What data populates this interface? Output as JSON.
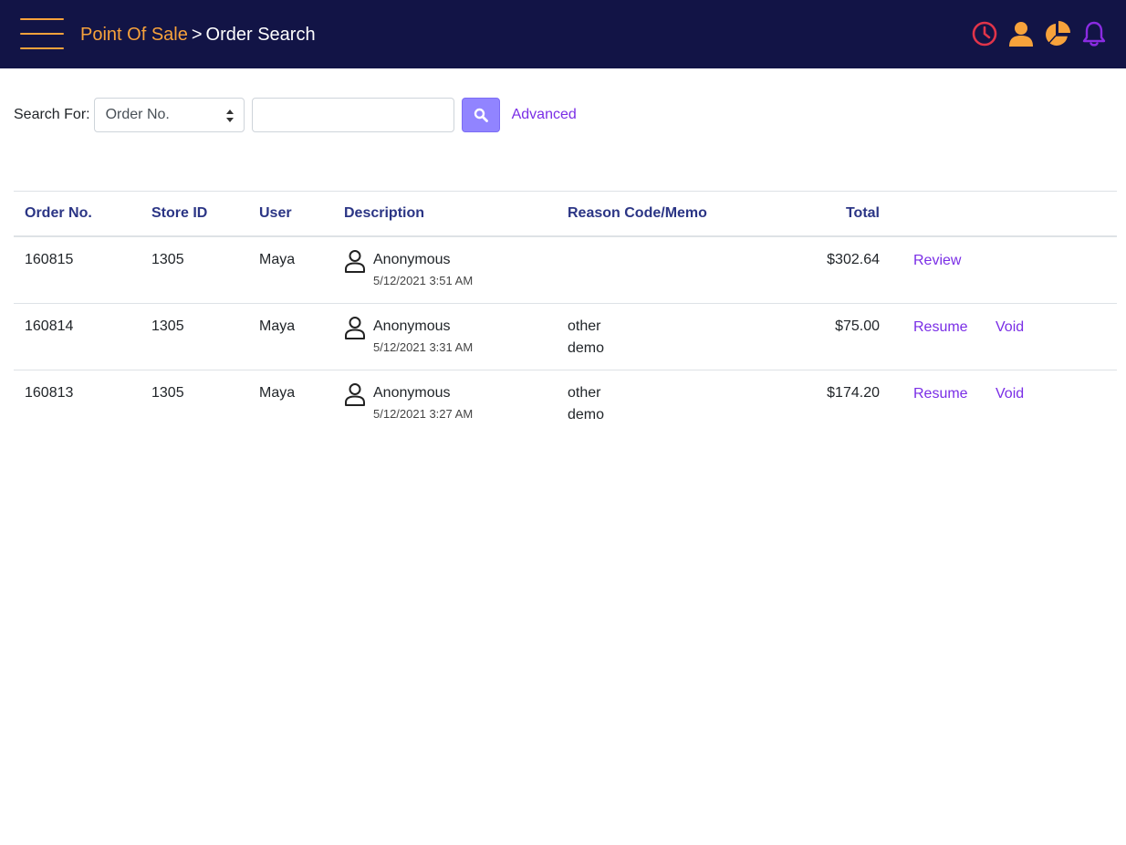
{
  "header": {
    "breadcrumb_home": "Point Of Sale",
    "breadcrumb_sep": ">",
    "breadcrumb_current": "Order Search",
    "icons": [
      "clock-icon",
      "user-icon",
      "pie-chart-icon",
      "bell-icon"
    ],
    "colors": {
      "bar": "#121446",
      "accent": "#f7a23b",
      "clock": "#e0344a",
      "bell": "#8a2be2"
    }
  },
  "search": {
    "label": "Search For:",
    "select_value": "Order No.",
    "input_value": "",
    "advanced_label": "Advanced"
  },
  "table": {
    "headers": [
      "Order No.",
      "Store ID",
      "User",
      "Description",
      "Reason Code/Memo",
      "Total"
    ],
    "rows": [
      {
        "order_no": "160815",
        "store_id": "1305",
        "user": "Maya",
        "desc_name": "Anonymous",
        "desc_date": "5/12/2021 3:51 AM",
        "memo_line1": "",
        "memo_line2": "",
        "total": "$302.64",
        "action1": "Review",
        "action2": ""
      },
      {
        "order_no": "160814",
        "store_id": "1305",
        "user": "Maya",
        "desc_name": "Anonymous",
        "desc_date": "5/12/2021 3:31 AM",
        "memo_line1": "other",
        "memo_line2": "demo",
        "total": "$75.00",
        "action1": "Resume",
        "action2": "Void"
      },
      {
        "order_no": "160813",
        "store_id": "1305",
        "user": "Maya",
        "desc_name": "Anonymous",
        "desc_date": "5/12/2021 3:27 AM",
        "memo_line1": "other",
        "memo_line2": "demo",
        "total": "$174.20",
        "action1": "Resume",
        "action2": "Void"
      }
    ]
  }
}
